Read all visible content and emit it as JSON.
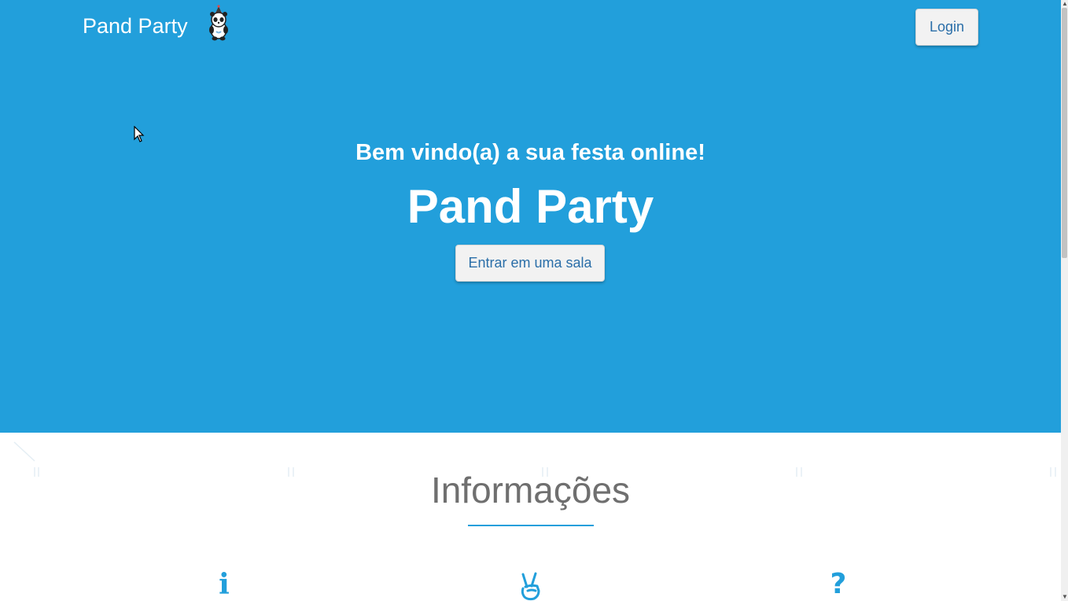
{
  "nav": {
    "brand": "Pand Party",
    "brand_logo_icon": "panda-party-hat-icon",
    "login_label": "Login"
  },
  "hero": {
    "subtitle": "Bem vindo(a) a sua festa online!",
    "title": "Pand Party",
    "enter_label": "Entrar em uma sala"
  },
  "info": {
    "title": "Informações",
    "features": [
      {
        "icon": "info-icon",
        "glyph": "i"
      },
      {
        "icon": "peace-hand-icon",
        "glyph": ""
      },
      {
        "icon": "question-icon",
        "glyph": "?"
      }
    ]
  },
  "colors": {
    "primary": "#229fdb",
    "button_bg": "#f2f2f2",
    "button_text": "#2a6ea8",
    "heading_gray": "#6f6f6f"
  }
}
